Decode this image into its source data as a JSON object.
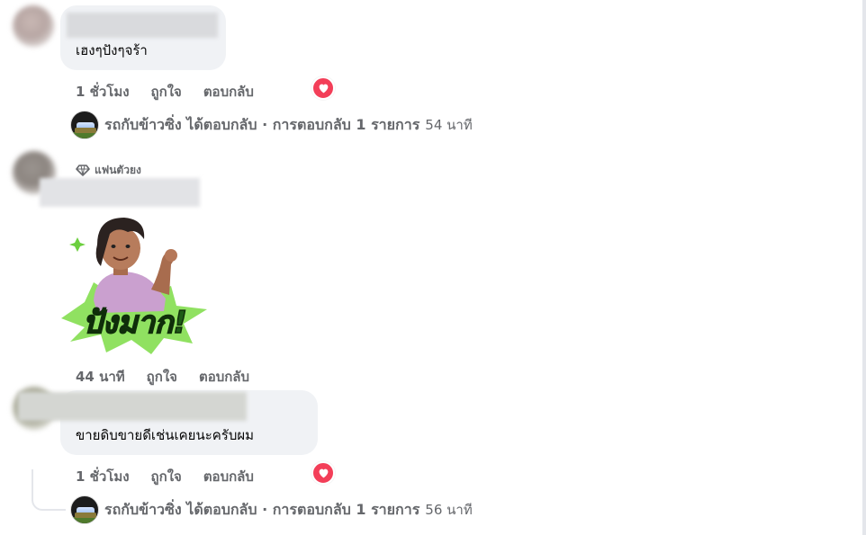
{
  "comments": [
    {
      "text": "เฮงๆปังๆจร้า",
      "actions": {
        "time": "1 ชั่วโมง",
        "like": "ถูกใจ",
        "reply": "ตอบกลับ"
      },
      "reaction_icon": "heart-icon",
      "reply_summary": {
        "text": "รถกับข้าวซิ่ง ได้ตอบกลับ · การตอบกลับ 1 รายการ",
        "time": "54 นาที"
      }
    },
    {
      "badge": "แฟนตัวยง",
      "sticker_text": "ปังมาก!",
      "actions": {
        "time": "44 นาที",
        "like": "ถูกใจ",
        "reply": "ตอบกลับ"
      }
    },
    {
      "text": "ขายดิบขายดีเช่นเคยนะครับผม",
      "actions": {
        "time": "1 ชั่วโมง",
        "like": "ถูกใจ",
        "reply": "ตอบกลับ"
      },
      "reaction_icon": "heart-icon",
      "reply_summary": {
        "text": "รถกับข้าวซิ่ง ได้ตอบกลับ · การตอบกลับ 1 รายการ",
        "time": "56 นาที"
      }
    }
  ],
  "colors": {
    "heart": "#f33e58",
    "bubble": "#f0f2f5",
    "secondary_text": "#65676b",
    "sticker_green": "#58c43a"
  }
}
